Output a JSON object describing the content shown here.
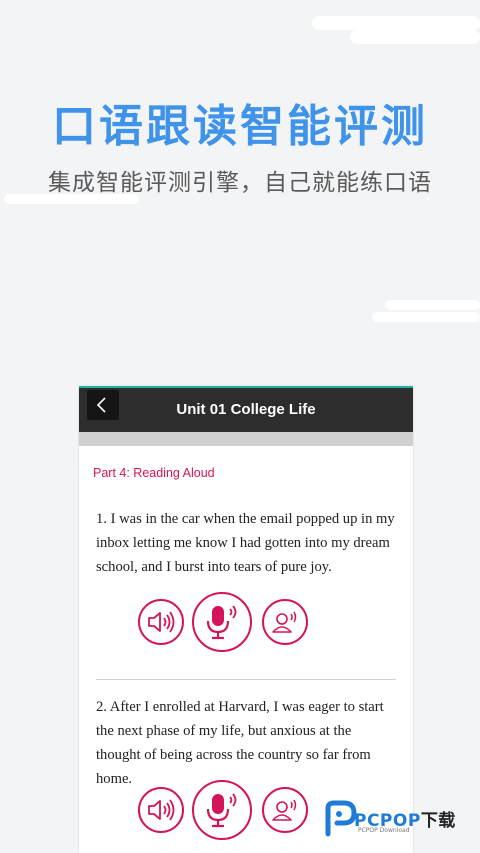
{
  "promo": {
    "headline": "口语跟读智能评测",
    "subhead": "集成智能评测引擎，自己就能练口语"
  },
  "app": {
    "title": "Unit 01 College Life",
    "section_title": "Part 4: Reading Aloud",
    "items": [
      {
        "text": "1. I was in the car when the email popped up in my inbox letting me know I had gotten into my dream school, and I burst into tears of pure joy."
      },
      {
        "text": "2. After I enrolled at Harvard, I was eager to start the next phase of my life, but anxious at the thought of being across the country so far from home."
      }
    ],
    "icons": {
      "back": "chevron-left-icon",
      "play": "speaker-icon",
      "record": "microphone-icon",
      "playback": "user-voice-icon"
    }
  },
  "watermark": {
    "brand": "PCPOP",
    "suffix": "下载",
    "small": "PCPOP Download"
  },
  "colors": {
    "accent": "#d4145a",
    "headline": "#3f93e8",
    "topbar": "#2d2d2d"
  }
}
